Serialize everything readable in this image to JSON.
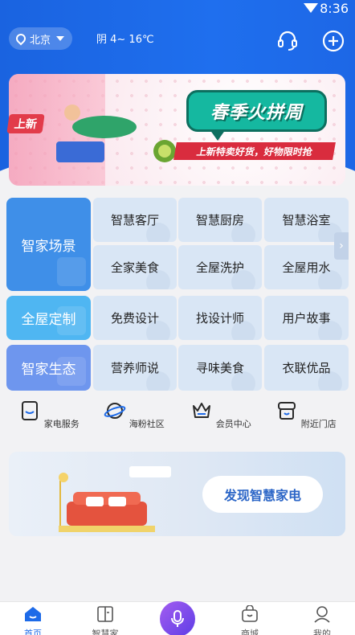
{
  "status_bar": {
    "time": "8:36"
  },
  "header": {
    "city": "北京",
    "weather": "阴 4~ 16℃",
    "icons": [
      "location-icon",
      "customer-service-icon",
      "add-icon"
    ]
  },
  "banner": {
    "tag": "上新",
    "title": "春季火拼周",
    "subtitle": "上新特卖好货，好物限时抢"
  },
  "categories": [
    {
      "label": "智家场景",
      "color": "#3f8fe8",
      "items": [
        "智慧客厅",
        "智慧厨房",
        "智慧浴室",
        "全家美食",
        "全屋洗护",
        "全屋用水"
      ]
    },
    {
      "label": "全屋定制",
      "color": "#4fb6f2",
      "items": [
        "免费设计",
        "找设计师",
        "用户故事"
      ]
    },
    {
      "label": "智家生态",
      "color": "#6e96ee",
      "items": [
        "营养师说",
        "寻味美食",
        "衣联优品"
      ]
    }
  ],
  "services": [
    {
      "label": "家电服务",
      "icon": "appliance-service-icon"
    },
    {
      "label": "海粉社区",
      "icon": "planet-community-icon"
    },
    {
      "label": "会员中心",
      "icon": "crown-member-icon"
    },
    {
      "label": "附近门店",
      "icon": "store-icon"
    }
  ],
  "promo": {
    "button": "发现智慧家电"
  },
  "tabs": [
    {
      "label": "首页",
      "icon": "home-icon",
      "active": true
    },
    {
      "label": "智慧家",
      "icon": "smart-home-icon",
      "active": false
    },
    {
      "label": "",
      "icon": "microphone-icon",
      "active": false
    },
    {
      "label": "商城",
      "icon": "shopping-bag-icon",
      "active": false
    },
    {
      "label": "我的",
      "icon": "profile-icon",
      "active": false
    }
  ]
}
